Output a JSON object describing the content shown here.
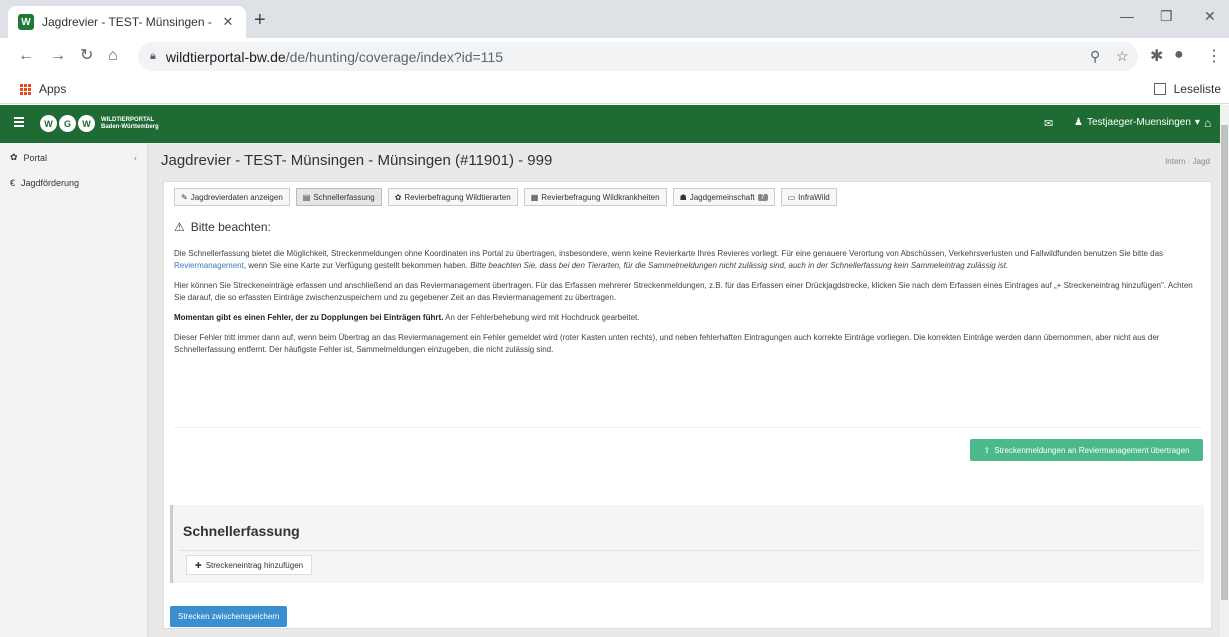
{
  "browser": {
    "tab_title": "Jagdrevier - TEST- Münsingen - ",
    "tab_favicon": "W",
    "tab_close": "✕",
    "new_tab": "+",
    "url_domain": "wildtierportal-bw.de",
    "url_path": "/de/hunting/coverage/index?id=115",
    "bookmarks_apps": "Apps",
    "reading_list": "Leseliste"
  },
  "app": {
    "logo_letters": [
      "W",
      "G",
      "W"
    ],
    "logo_text_1": "WILDTIERPORTAL",
    "logo_text_2": "Baden-Württemberg",
    "user": "Testjaeger-Muensingen",
    "user_caret": "▾"
  },
  "sidebar": {
    "items": [
      {
        "label": "Portal",
        "icon": "gear-icon"
      },
      {
        "label": "Jagdförderung",
        "icon": "euro-icon"
      }
    ]
  },
  "main": {
    "title": "Jagdrevier - TEST- Münsingen - Münsingen (#11901) - 999",
    "breadcrumb": "Intern  ·  Jagd",
    "tabs": [
      {
        "label": "Jagdrevierdaten anzeigen",
        "icon": "✎"
      },
      {
        "label": "Schnellerfassung",
        "icon": "▤"
      },
      {
        "label": "Revierbefragung Wildtierarten",
        "icon": "✿"
      },
      {
        "label": "Revierbefragung Wildkrankheiten",
        "icon": "▦"
      },
      {
        "label": "Jagdgemeinschaft",
        "icon": "☗",
        "badge": "7"
      },
      {
        "label": "InfraWild",
        "icon": "▭"
      }
    ],
    "notice_title": "Bitte beachten:",
    "p1_a": "Die Schnellerfassung bietet die Möglichkeit, Streckenmeldungen ohne Koordinaten ins Portal zu übertragen, insbesondere, wenn keine Revierkarte Ihres Revieres vorliegt. Für eine genauere Verortung von Abschüssen, Verkehrsverlusten und Fallwildfunden benutzen Sie bitte das ",
    "p1_link": "Reviermanagement",
    "p1_b": ", wenn Sie eine Karte zur Verfügung gestellt bekommen haben. ",
    "p1_em": "Bitte beachten Sie, dass bei den Tierarten, für die Sammelmeldungen nicht zulässig sind, auch in der Schnellerfassung kein Sammeleintrag zulässig ist.",
    "p2": "Hier können Sie Streckeneinträge erfassen und anschließend an das Reviermanagement übertragen. Für das Erfassen mehrerer Streckenmeldungen, z.B. für das Erfassen einer Drückjagdstrecke, klicken Sie nach dem Erfassen eines Eintrages auf „+ Streckeneintrag hinzufügen\". Achten Sie darauf, die so erfassten Einträge zwischenzuspeichern und zu gegebener Zeit an das Reviermanagement zu übertragen.",
    "p3_bold": "Momentan gibt es einen Fehler, der zu Dopplungen bei Einträgen führt.",
    "p3_rest": " An der Fehlerbehebung wird mit Hochdruck gearbeitet.",
    "p4": "Dieser Fehler tritt immer dann auf, wenn beim Übertrag an das Reviermanagement ein Fehler gemeldet wird (roter Kasten unten rechts), und neben fehlerhaften Eintragungen auch korrekte Einträge vorliegen. Die korrekten Einträge werden dann übernommen, aber nicht aus der Schnellerfassung entfernt. Der häufigste Fehler ist, Sammelmeldungen einzugeben, die nicht zulässig sind.",
    "transfer_button": "Streckenmeldungen an Reviermanagement übertragen",
    "section_title": "Schnellerfassung",
    "add_entry": "Streckeneintrag hinzufügen",
    "save_button": "Strecken zwischenspeichern"
  },
  "colors": {
    "brand_green": "#1e6b34",
    "success": "#4cb98a",
    "primary": "#3a8fd0"
  }
}
